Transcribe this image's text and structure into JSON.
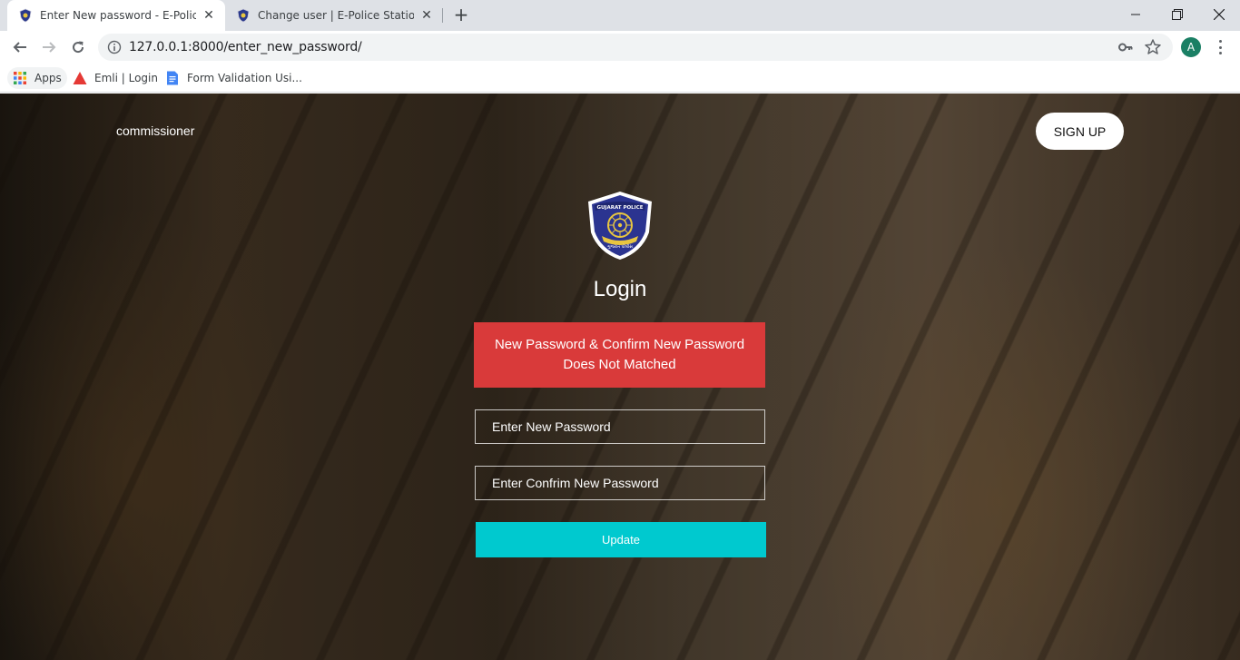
{
  "browser": {
    "tabs": [
      {
        "title": "Enter New password - E-Police St",
        "active": true
      },
      {
        "title": "Change user | E-Police Station",
        "active": false
      }
    ],
    "address": {
      "url": "127.0.0.1:8000/enter_new_password/"
    },
    "profile_initial": "A",
    "bookmarks": [
      {
        "label": "Apps",
        "icon": "apps-grid-icon"
      },
      {
        "label": "Emli | Login",
        "icon": "emli-triangle-icon"
      },
      {
        "label": "Form Validation Usi...",
        "icon": "google-docs-icon"
      }
    ]
  },
  "header": {
    "brand": "commissioner",
    "signup_label": "SIGN UP"
  },
  "logo": {
    "top_text": "GUJARAT POLICE",
    "bottom_text": "ગુજરાત પોલીસ"
  },
  "form": {
    "title": "Login",
    "error_message": "New Password & Confirm New Password Does Not Matched",
    "new_password_placeholder": "Enter New Password",
    "confirm_password_placeholder": "Enter Confrim New Password",
    "submit_label": "Update"
  },
  "colors": {
    "alert": "#d93a3a",
    "update_button": "#00c9cf",
    "tabstrip": "#dee1e6",
    "avatar": "#1a7f64"
  }
}
